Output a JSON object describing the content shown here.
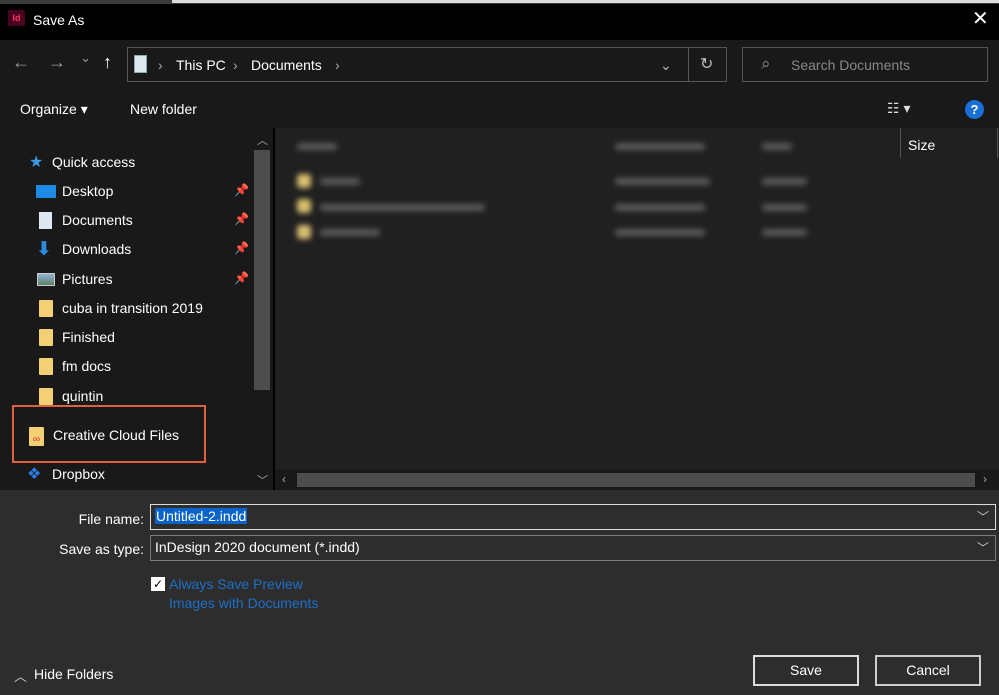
{
  "window": {
    "title": "Save As",
    "app_icon": "Id",
    "close": "✕"
  },
  "nav": {
    "back": "←",
    "forward": "→",
    "recent": "⌄",
    "up": "↑",
    "breadcrumb": [
      "This PC",
      "Documents"
    ],
    "separator": "›",
    "refresh": "↻",
    "dropdown": "⌄"
  },
  "search": {
    "placeholder": "Search Documents",
    "icon": "⌕"
  },
  "toolbar": {
    "organize": "Organize ▾",
    "new_folder": "New folder",
    "view": "☷ ▾",
    "help": "?"
  },
  "sidebar": {
    "items": [
      {
        "label": "Quick access",
        "icon": "star-icon"
      },
      {
        "label": "Desktop",
        "icon": "desktop-icon",
        "pinned": true
      },
      {
        "label": "Documents",
        "icon": "documents-icon",
        "pinned": true
      },
      {
        "label": "Downloads",
        "icon": "download-icon",
        "pinned": true
      },
      {
        "label": "Pictures",
        "icon": "pictures-icon",
        "pinned": true
      },
      {
        "label": "cuba in transition 2019",
        "icon": "folder-icon"
      },
      {
        "label": "Finished",
        "icon": "folder-icon"
      },
      {
        "label": "fm docs",
        "icon": "folder-icon"
      },
      {
        "label": "quintin",
        "icon": "folder-icon"
      },
      {
        "label": "Creative Cloud Files",
        "icon": "creative-cloud-folder-icon",
        "highlighted": true
      },
      {
        "label": "Dropbox",
        "icon": "dropbox-icon"
      }
    ],
    "pin": "📌"
  },
  "columns": {
    "size": "Size"
  },
  "form": {
    "file_name_label": "File name:",
    "file_name_value": "Untitled-2.indd",
    "type_label": "Save as type:",
    "type_value": "InDesign 2020 document (*.indd)",
    "preview_checked": true,
    "preview_label": "Always Save Preview Images with Documents"
  },
  "footer": {
    "hide_folders": "Hide Folders",
    "save": "Save",
    "cancel": "Cancel"
  },
  "colors": {
    "highlight_box": "#e0603f",
    "link": "#1e6fc8",
    "selection": "#0a64c8"
  }
}
